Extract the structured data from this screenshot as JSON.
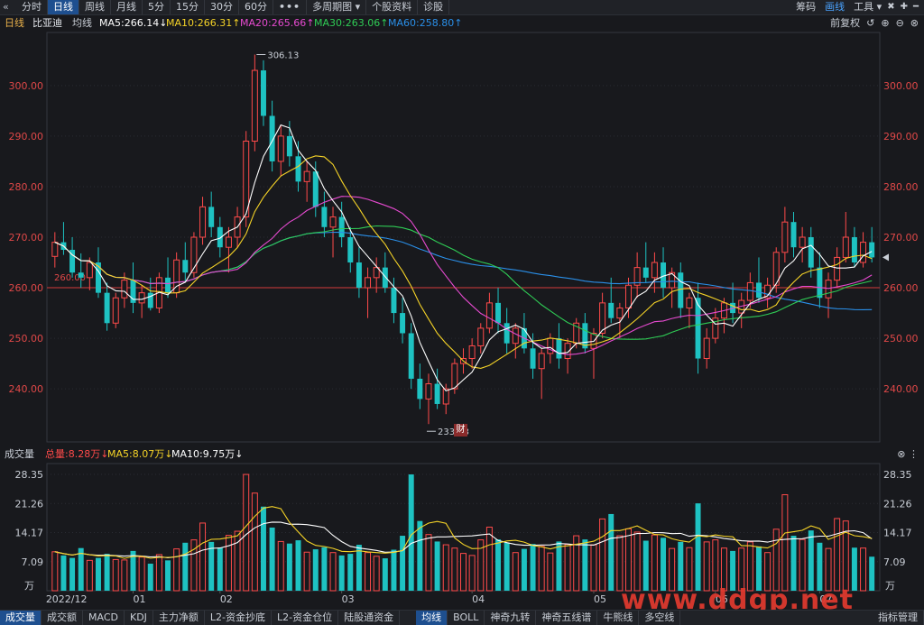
{
  "toolbar": {
    "back_icon": "double-chevron-left-icon",
    "tabs": [
      "分时",
      "日线",
      "周线",
      "月线",
      "5分",
      "15分",
      "30分",
      "60分",
      "•••",
      "多周期图 ▾",
      "个股资料",
      "诊股"
    ],
    "active_tab": "日线",
    "right": {
      "chips": "筹码",
      "draw": "画线",
      "tools": "工具 ▾",
      "icons": [
        "close-circle-icon",
        "plus-circle-icon",
        "minus-circle-icon"
      ]
    }
  },
  "info": {
    "period": "日线",
    "stock": "比亚迪",
    "ma_label": "均线",
    "ma5": "MA5:266.14↓",
    "ma10": "MA10:266.31↑",
    "ma20": "MA20:265.66↑",
    "ma30": "MA30:263.06↑",
    "ma60": "MA60:258.80↑",
    "right": {
      "fq": "前复权",
      "icons": [
        "undo-icon",
        "plus-circle-icon",
        "minus-circle-icon",
        "close-circle-icon"
      ]
    }
  },
  "volume_info": {
    "label": "成交量",
    "total": "总量:8.28万↓",
    "ma5": "MA5:8.07万↓",
    "ma10": "MA10:9.75万↓",
    "close_icon": "close-circle-icon"
  },
  "colors": {
    "up": "#ff4a4a",
    "down": "#1ec2c2",
    "ma5": "#ffffff",
    "ma10": "#f5d327",
    "ma20": "#e64ad0",
    "ma30": "#2fcc55",
    "ma60": "#2a8fe8",
    "refline": "#d33a3a"
  },
  "chart_data": {
    "type": "candlestick",
    "price_axis": {
      "ticks": [
        "300.00",
        "290.00",
        "280.00",
        "270.00",
        "260.00",
        "250.00",
        "240.00"
      ],
      "values": [
        300,
        290,
        280,
        270,
        260,
        250,
        240
      ]
    },
    "annotations": {
      "high": "306.13",
      "low": "233.03",
      "reference": "260.00",
      "event_marker": "财"
    },
    "volume_axis": {
      "ticks": [
        "28.35",
        "21.26",
        "14.17",
        "7.09",
        "万"
      ],
      "values": [
        28.35,
        21.26,
        14.17,
        7.09
      ]
    },
    "x_labels": [
      "2022/12",
      "01",
      "02",
      "03",
      "04",
      "05",
      "06",
      "07"
    ],
    "note_reference_line": 260.0,
    "candles": [
      [
        266.2,
        271.0,
        264.0,
        269.0,
        9.5
      ],
      [
        269.0,
        273.0,
        266.5,
        267.5,
        8.6
      ],
      [
        267.5,
        270.0,
        262.0,
        263.0,
        8.0
      ],
      [
        263.0,
        266.8,
        260.0,
        262.0,
        10.4
      ],
      [
        262.0,
        266.0,
        259.5,
        265.0,
        7.4
      ],
      [
        265.0,
        268.0,
        258.0,
        259.0,
        8.0
      ],
      [
        259.0,
        261.0,
        251.5,
        253.0,
        9.0
      ],
      [
        253.0,
        259.0,
        252.0,
        258.0,
        7.6
      ],
      [
        258.0,
        263.0,
        256.0,
        261.5,
        7.5
      ],
      [
        261.5,
        265.0,
        255.0,
        257.0,
        9.7
      ],
      [
        257.0,
        260.5,
        254.0,
        259.0,
        8.2
      ],
      [
        259.0,
        262.0,
        255.5,
        256.0,
        6.6
      ],
      [
        256.0,
        263.0,
        255.0,
        262.0,
        8.8
      ],
      [
        262.0,
        266.0,
        258.0,
        259.0,
        7.4
      ],
      [
        259.0,
        267.0,
        258.0,
        265.5,
        10.2
      ],
      [
        265.5,
        269.0,
        261.0,
        263.0,
        11.7
      ],
      [
        263.0,
        271.0,
        262.0,
        270.0,
        12.4
      ],
      [
        270.0,
        278.0,
        268.5,
        276.0,
        16.5
      ],
      [
        276.0,
        279.0,
        270.0,
        272.0,
        11.9
      ],
      [
        272.0,
        274.0,
        266.0,
        268.0,
        10.5
      ],
      [
        268.0,
        272.0,
        263.0,
        270.0,
        13.5
      ],
      [
        270.0,
        276.0,
        268.0,
        274.0,
        14.5
      ],
      [
        274.0,
        291.0,
        272.0,
        289.0,
        28.35
      ],
      [
        289.0,
        306.13,
        287.0,
        303.0,
        23.8
      ],
      [
        303.0,
        305.0,
        292.0,
        294.0,
        20.5
      ],
      [
        294.0,
        297.0,
        283.0,
        285.0,
        15.4
      ],
      [
        285.0,
        292.0,
        282.0,
        290.0,
        12.0
      ],
      [
        290.0,
        293.0,
        284.0,
        286.0,
        11.5
      ],
      [
        286.0,
        289.0,
        279.0,
        281.0,
        12.3
      ],
      [
        281.0,
        285.0,
        277.0,
        283.0,
        9.4
      ],
      [
        283.0,
        285.0,
        274.0,
        276.0,
        10.1
      ],
      [
        276.0,
        279.0,
        270.0,
        272.0,
        10.6
      ],
      [
        272.0,
        276.0,
        266.0,
        274.0,
        9.3
      ],
      [
        274.0,
        277.0,
        268.0,
        270.0,
        8.6
      ],
      [
        270.0,
        272.0,
        263.0,
        265.0,
        9.0
      ],
      [
        265.0,
        268.0,
        258.0,
        260.0,
        11.2
      ],
      [
        260.0,
        264.0,
        254.0,
        262.0,
        9.3
      ],
      [
        262.0,
        266.0,
        259.0,
        264.0,
        8.4
      ],
      [
        264.0,
        267.0,
        259.0,
        260.0,
        7.9
      ],
      [
        260.0,
        262.0,
        253.0,
        255.0,
        10.0
      ],
      [
        255.0,
        258.0,
        249.0,
        251.0,
        13.4
      ],
      [
        251.0,
        253.0,
        240.0,
        242.0,
        28.35
      ],
      [
        242.0,
        245.0,
        236.0,
        238.0,
        17.0
      ],
      [
        238.0,
        243.0,
        233.03,
        241.0,
        13.7
      ],
      [
        241.0,
        244.0,
        236.0,
        237.0,
        12.0
      ],
      [
        237.0,
        241.0,
        235.0,
        240.0,
        11.2
      ],
      [
        240.0,
        246.0,
        239.0,
        245.0,
        10.4
      ],
      [
        245.0,
        248.0,
        243.0,
        246.0,
        9.1
      ],
      [
        246.0,
        250.0,
        244.0,
        248.5,
        8.6
      ],
      [
        248.5,
        253.0,
        247.0,
        252.0,
        12.4
      ],
      [
        252.0,
        259.0,
        251.0,
        257.0,
        15.5
      ],
      [
        257.0,
        260.0,
        251.0,
        253.0,
        12.5
      ],
      [
        253.0,
        256.0,
        247.0,
        249.0,
        11.7
      ],
      [
        249.0,
        253.0,
        246.0,
        252.0,
        9.3
      ],
      [
        252.0,
        255.0,
        247.0,
        248.0,
        10.2
      ],
      [
        248.0,
        251.0,
        242.0,
        244.0,
        11.4
      ],
      [
        244.0,
        248.0,
        238.0,
        247.0,
        10.8
      ],
      [
        247.0,
        251.0,
        245.0,
        250.0,
        9.2
      ],
      [
        250.0,
        253.0,
        244.0,
        246.0,
        12.0
      ],
      [
        246.0,
        250.0,
        243.0,
        249.0,
        11.3
      ],
      [
        249.0,
        254.0,
        248.0,
        253.0,
        13.4
      ],
      [
        253.0,
        255.0,
        247.0,
        248.0,
        12.5
      ],
      [
        248.0,
        252.0,
        242.0,
        251.0,
        11.2
      ],
      [
        251.0,
        259.0,
        250.0,
        257.0,
        17.5
      ],
      [
        257.0,
        262.0,
        253.0,
        254.0,
        18.7
      ],
      [
        254.0,
        257.0,
        250.0,
        256.0,
        13.4
      ],
      [
        256.0,
        262.0,
        254.0,
        260.5,
        15.1
      ],
      [
        260.5,
        267.0,
        258.0,
        264.0,
        14.3
      ],
      [
        264.0,
        269.0,
        261.0,
        262.0,
        12.2
      ],
      [
        262.0,
        267.0,
        259.0,
        265.0,
        13.6
      ],
      [
        265.0,
        268.0,
        258.0,
        260.0,
        12.9
      ],
      [
        260.0,
        264.0,
        256.0,
        263.0,
        10.3
      ],
      [
        263.0,
        265.0,
        254.0,
        256.0,
        11.9
      ],
      [
        256.0,
        259.0,
        252.0,
        258.0,
        10.5
      ],
      [
        258.0,
        261.0,
        243.0,
        246.0,
        21.3
      ],
      [
        246.0,
        252.0,
        244.0,
        250.0,
        11.9
      ],
      [
        250.0,
        256.0,
        249.0,
        254.0,
        12.4
      ],
      [
        254.0,
        258.0,
        251.0,
        257.0,
        10.4
      ],
      [
        257.0,
        261.0,
        253.0,
        255.0,
        9.7
      ],
      [
        255.0,
        259.0,
        252.0,
        257.5,
        10.4
      ],
      [
        257.5,
        263.0,
        256.0,
        261.0,
        11.9
      ],
      [
        261.0,
        266.0,
        257.0,
        258.0,
        10.8
      ],
      [
        258.0,
        262.0,
        256.0,
        260.5,
        9.3
      ],
      [
        260.5,
        268.0,
        259.0,
        267.0,
        15.0
      ],
      [
        267.0,
        276.0,
        265.0,
        273.0,
        23.4
      ],
      [
        273.0,
        275.0,
        266.0,
        268.0,
        13.4
      ],
      [
        268.0,
        272.0,
        265.0,
        270.0,
        12.5
      ],
      [
        270.0,
        272.0,
        262.0,
        264.0,
        14.7
      ],
      [
        264.0,
        267.0,
        256.0,
        258.0,
        11.7
      ],
      [
        258.0,
        263.0,
        254.0,
        261.5,
        10.3
      ],
      [
        261.5,
        268.0,
        260.0,
        266.0,
        17.6
      ],
      [
        266.0,
        275.0,
        265.0,
        270.0,
        17.0
      ],
      [
        270.0,
        272.0,
        264.0,
        265.0,
        10.5
      ],
      [
        265.0,
        271.0,
        264.0,
        269.0,
        10.4
      ],
      [
        269.0,
        272.0,
        265.0,
        266.0,
        8.3
      ]
    ],
    "ma_series_note": "MA lines drawn from visible approximations of the moving averages"
  },
  "bottom_tabs": {
    "left": [
      "成交量",
      "成交额",
      "MACD",
      "KDJ",
      "主力净额",
      "L2-资金抄底",
      "L2-资金仓位",
      "陆股通资金"
    ],
    "right": [
      "均线",
      "BOLL",
      "神奇九转",
      "神奇五线谱",
      "牛熊线",
      "多空线",
      "指标管理"
    ],
    "active_left": "成交量",
    "active_right": "均线"
  },
  "watermark": "www.ddgp.net"
}
